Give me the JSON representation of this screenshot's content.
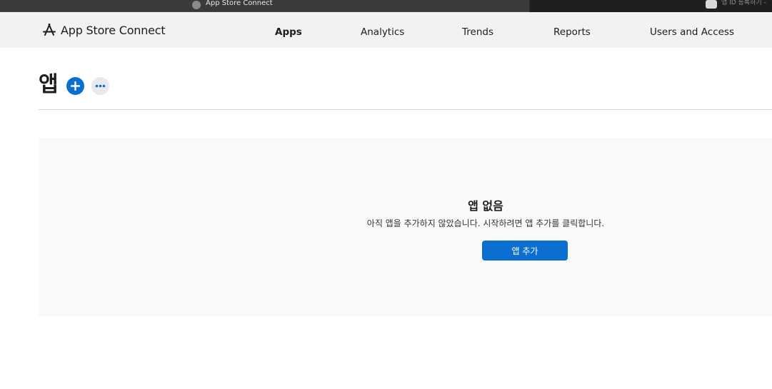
{
  "browser": {
    "active_tab_title": "App Store Connect",
    "inactive_tab_title": "앱 ID 등록하기 -"
  },
  "header": {
    "brand_name": "App Store Connect",
    "nav": [
      {
        "label": "Apps",
        "active": true
      },
      {
        "label": "Analytics",
        "active": false
      },
      {
        "label": "Trends",
        "active": false
      },
      {
        "label": "Reports",
        "active": false
      },
      {
        "label": "Users and Access",
        "active": false
      }
    ]
  },
  "page": {
    "title": "앱"
  },
  "empty_state": {
    "title": "앱 없음",
    "description": "아직 앱을 추가하지 않았습니다. 시작하려면 앱 추가를 클릭합니다.",
    "button_label": "앱 추가"
  },
  "colors": {
    "accent": "#0a6fd1",
    "header_bg": "#f2f2f2",
    "panel_bg": "#f9f9f9"
  },
  "icons": {
    "brand": "app-store-a-icon",
    "add": "plus-icon",
    "more": "ellipsis-icon"
  }
}
